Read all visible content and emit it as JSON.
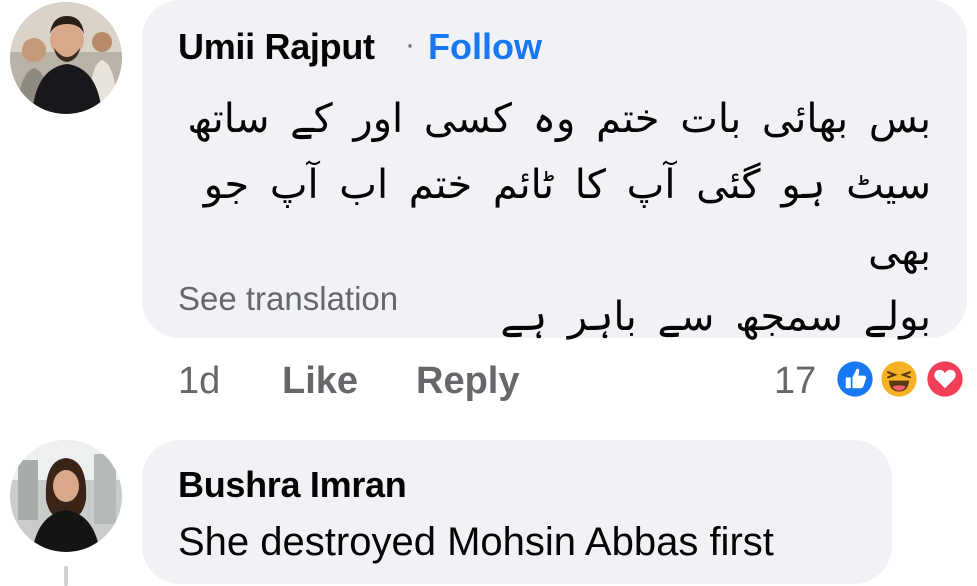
{
  "comments": [
    {
      "author": "Umii Rajput",
      "separator": "·",
      "follow_label": "Follow",
      "text_lines": [
        "بس بھائی بات ختم وہ کسی اور کے ساتھ",
        "سیٹ ہو گئی آپ کا ٹائم ختم اب آپ جو بھی",
        "بولے سمجھ سے باہر ہے"
      ],
      "see_translation": "See translation",
      "time": "1d",
      "like_label": "Like",
      "reply_label": "Reply",
      "reaction_count": "17",
      "reactions": [
        "like-icon",
        "haha-icon",
        "love-icon"
      ]
    },
    {
      "author": "Bushra Imran",
      "text": "She destroyed Mohsin Abbas first"
    }
  ],
  "colors": {
    "bubble": "#f0f2f5",
    "link": "#1877f2",
    "secondary_text": "#65676b",
    "like_reaction": "#1877f2",
    "haha_reaction": "#f7b125",
    "love_reaction": "#f33e58"
  }
}
